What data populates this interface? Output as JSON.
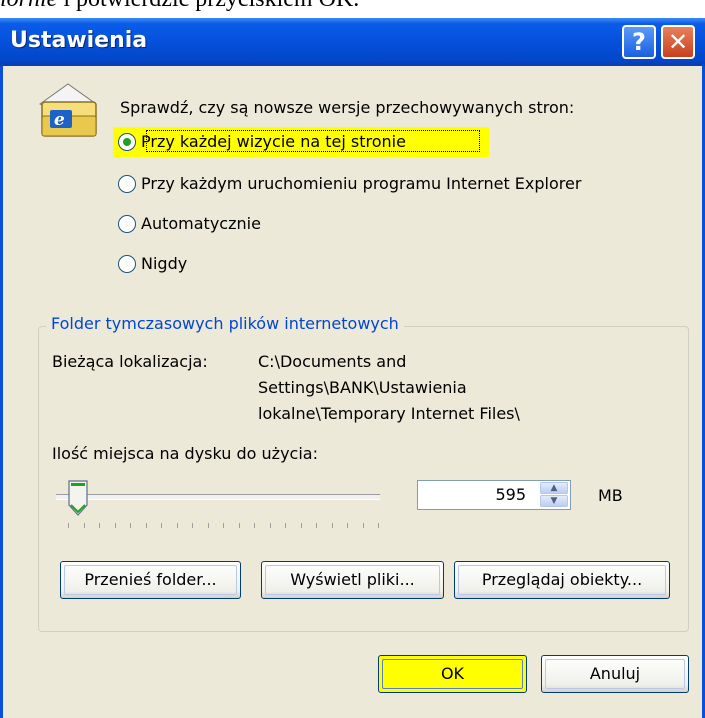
{
  "caption": {
    "italic_text": "iornie",
    "rest_text": " i potwierdzić przyciskiem OK."
  },
  "window": {
    "title": "Ustawienia",
    "help_label": "?",
    "close_label": "✕",
    "accent_color": "#0a4fd8"
  },
  "check_newer": {
    "prompt": "Sprawdź, czy są nowsze wersje przechowywanych stron:",
    "options": [
      {
        "label": "Przy każdej wizycie na tej stronie",
        "checked": true,
        "highlight": "#ffff00"
      },
      {
        "label": "Przy każdym uruchomieniu programu Internet Explorer",
        "checked": false
      },
      {
        "label": "Automatycznie",
        "checked": false
      },
      {
        "label": "Nigdy",
        "checked": false
      }
    ]
  },
  "temp_folder": {
    "group_title": "Folder tymczasowych plików internetowych",
    "location_label": "Bieżąca lokalizacja:",
    "location_lines": [
      "C:\\Documents and",
      "Settings\\BANK\\Ustawienia",
      "lokalne\\Temporary Internet Files\\"
    ],
    "disk_space_label": "Ilość miejsca na dysku do użycia:",
    "disk_space_value": "595",
    "unit": "MB",
    "slider_level": 0.03
  },
  "buttons": {
    "move_folder": "Przenieś folder...",
    "view_files": "Wyświetl pliki...",
    "view_objects": "Przeglądaj obiekty...",
    "ok": "OK",
    "cancel": "Anuluj"
  },
  "icons": {
    "window_icon": "internet-explorer-folder-icon"
  }
}
